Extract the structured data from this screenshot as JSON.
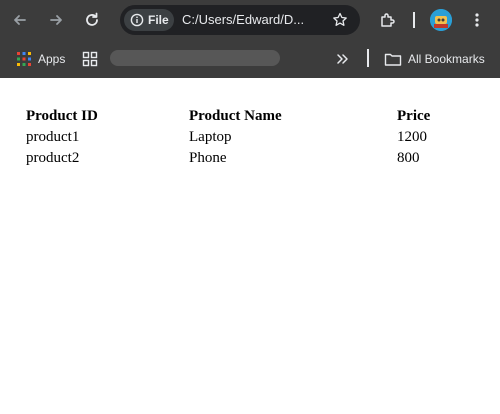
{
  "browser": {
    "url": "C:/Users/Edward/D...",
    "site_chip_label": "File",
    "colors": {
      "frame": "#3c3c3c",
      "omnibox": "#202124",
      "chip": "#3c4043",
      "text": "#e8eaed"
    }
  },
  "bookmarks_bar": {
    "apps_label": "Apps",
    "all_bookmarks_label": "All Bookmarks"
  },
  "table": {
    "headers": [
      "Product ID",
      "Product Name",
      "Price"
    ],
    "rows": [
      [
        "product1",
        "Laptop",
        "1200"
      ],
      [
        "product2",
        "Phone",
        "800"
      ]
    ]
  }
}
